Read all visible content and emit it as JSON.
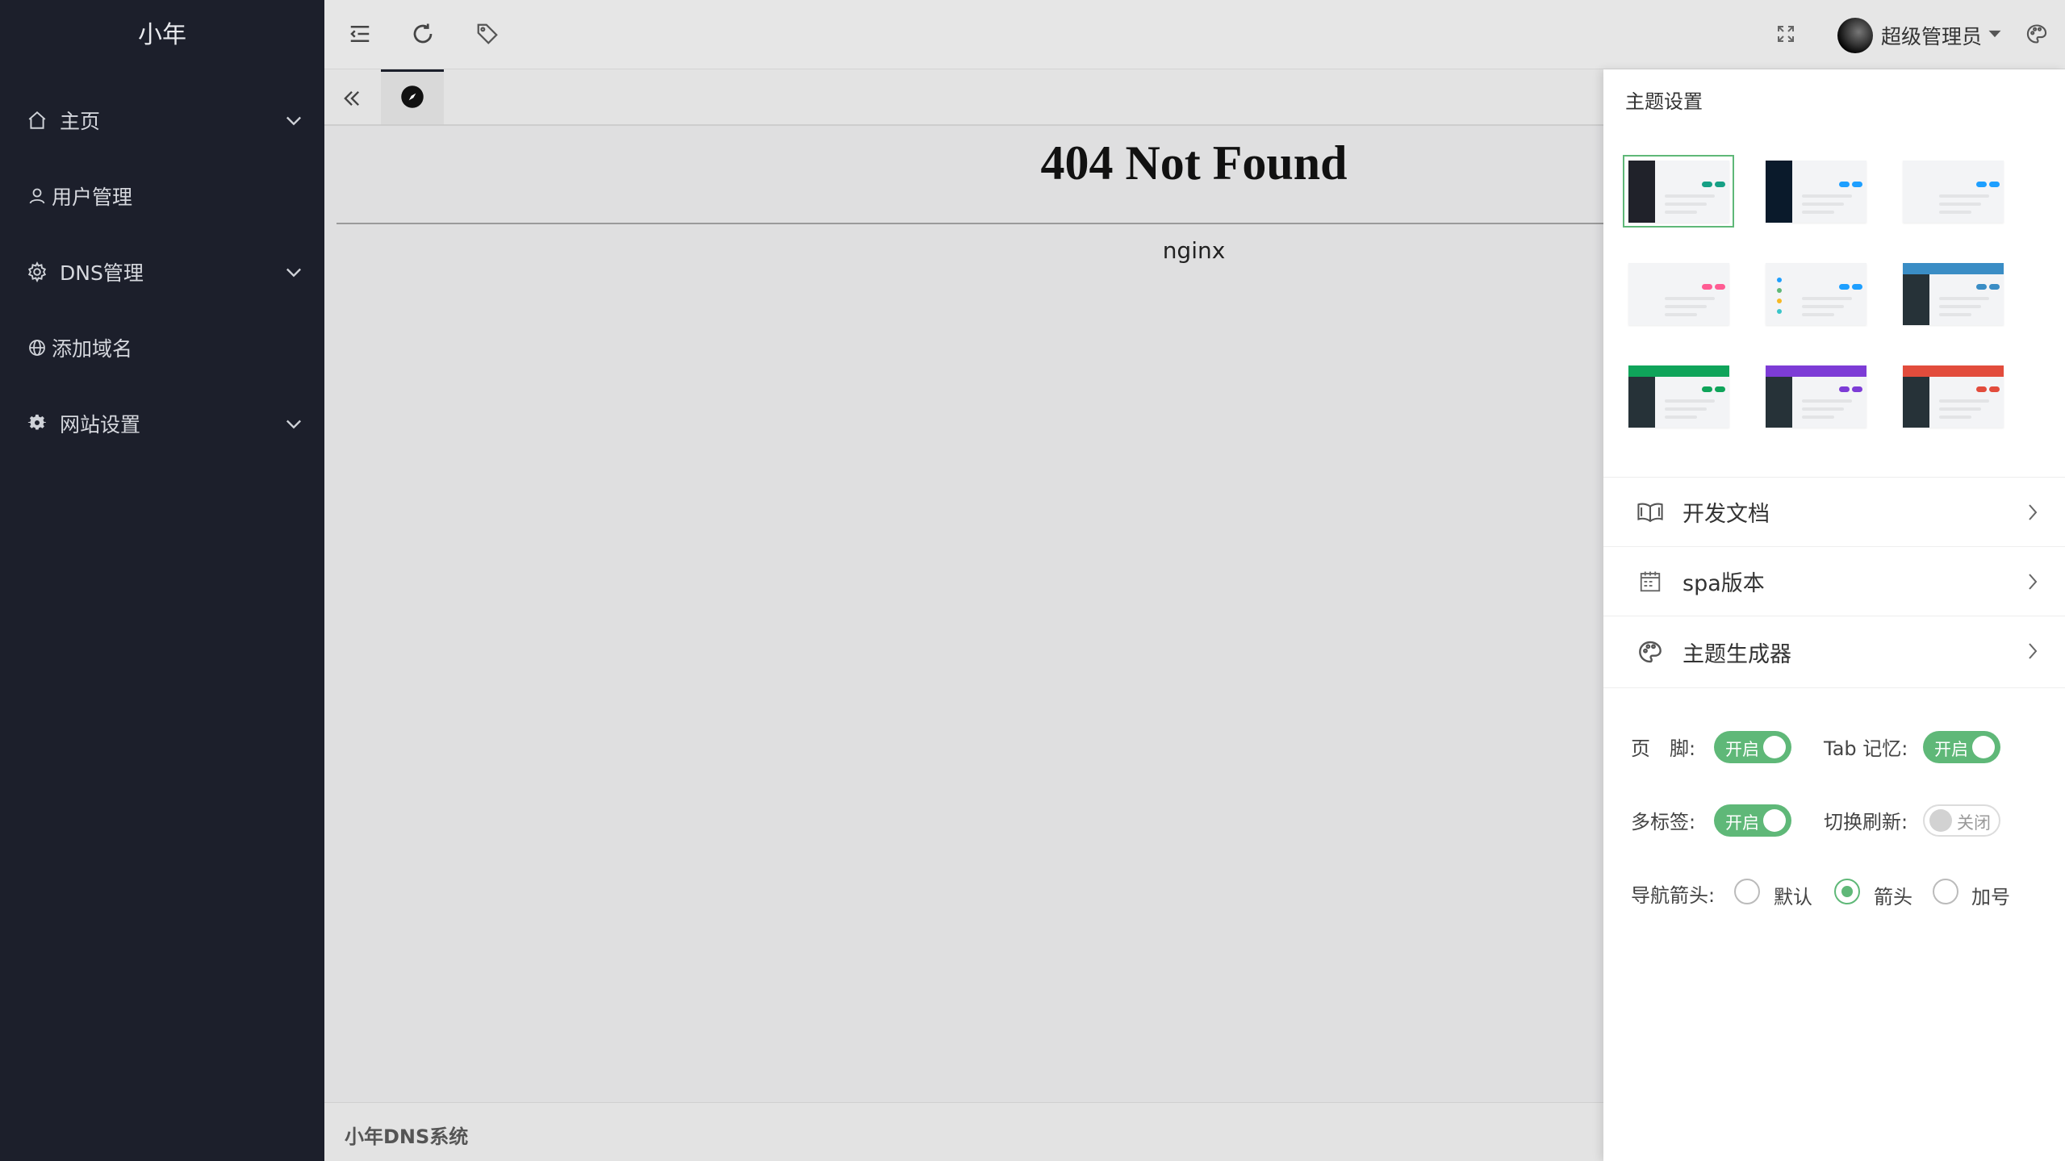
{
  "sidebar": {
    "logo": "小年",
    "items": [
      {
        "label": "主页",
        "icon": "home-icon",
        "has_children": true
      },
      {
        "label": "用户管理",
        "icon": "user-icon",
        "has_children": false
      },
      {
        "label": "DNS管理",
        "icon": "gear-icon",
        "has_children": true
      },
      {
        "label": "添加域名",
        "icon": "globe-icon",
        "has_children": false
      },
      {
        "label": "网站设置",
        "icon": "cog-icon",
        "has_children": true
      }
    ]
  },
  "header": {
    "icons": [
      "menu-collapse-icon",
      "refresh-icon",
      "tag-icon",
      "fullscreen-icon",
      "palette-icon"
    ],
    "user_name": "超级管理员"
  },
  "tabs": {
    "active_icon": "compass-icon"
  },
  "content": {
    "error_title": "404 Not Found",
    "server_name": "nginx"
  },
  "footer": {
    "text": "小年DNS系统"
  },
  "theme_panel": {
    "title": "主题设置",
    "themes": [
      {
        "side": "#20222a",
        "top": "",
        "dot": "#16a085",
        "selected": true
      },
      {
        "side": "#0a1a2b",
        "top": "",
        "dot": "#1e9fff",
        "selected": false
      },
      {
        "side": "",
        "top": "",
        "dot": "#1e9fff",
        "selected": false
      },
      {
        "side": "",
        "top": "",
        "dot": "#ff5c93",
        "selected": false
      },
      {
        "side": "multi",
        "top": "",
        "dot": "#1e9fff",
        "selected": false
      },
      {
        "side": "#263238",
        "top": "#3a8dc5",
        "dot": "#3a8dc5",
        "selected": false
      },
      {
        "side": "#263238",
        "top": "#0fa45a",
        "dot": "#0fa45a",
        "selected": false
      },
      {
        "side": "#263238",
        "top": "#7d3cd6",
        "dot": "#7d3cd6",
        "selected": false
      },
      {
        "side": "#263238",
        "top": "#e24c3c",
        "dot": "#e24c3c",
        "selected": false
      }
    ],
    "links": [
      {
        "label": "开发文档",
        "icon": "book-icon"
      },
      {
        "label": "spa版本",
        "icon": "calendar-icon"
      },
      {
        "label": "主题生成器",
        "icon": "palette-icon"
      }
    ],
    "options": {
      "footer_label": "页　脚:",
      "footer_state": "开启",
      "tab_memory_label": "Tab 记忆:",
      "tab_memory_state": "开启",
      "multi_tab_label": "多标签:",
      "multi_tab_state": "开启",
      "switch_refresh_label": "切换刷新:",
      "switch_refresh_state": "关闭",
      "nav_arrow_label": "导航箭头:",
      "nav_arrow_options": [
        "默认",
        "箭头",
        "加号"
      ],
      "nav_arrow_selected": "箭头"
    }
  },
  "colors": {
    "sidebar_bg": "#1c1f2b",
    "accent_green": "#5fb878"
  }
}
